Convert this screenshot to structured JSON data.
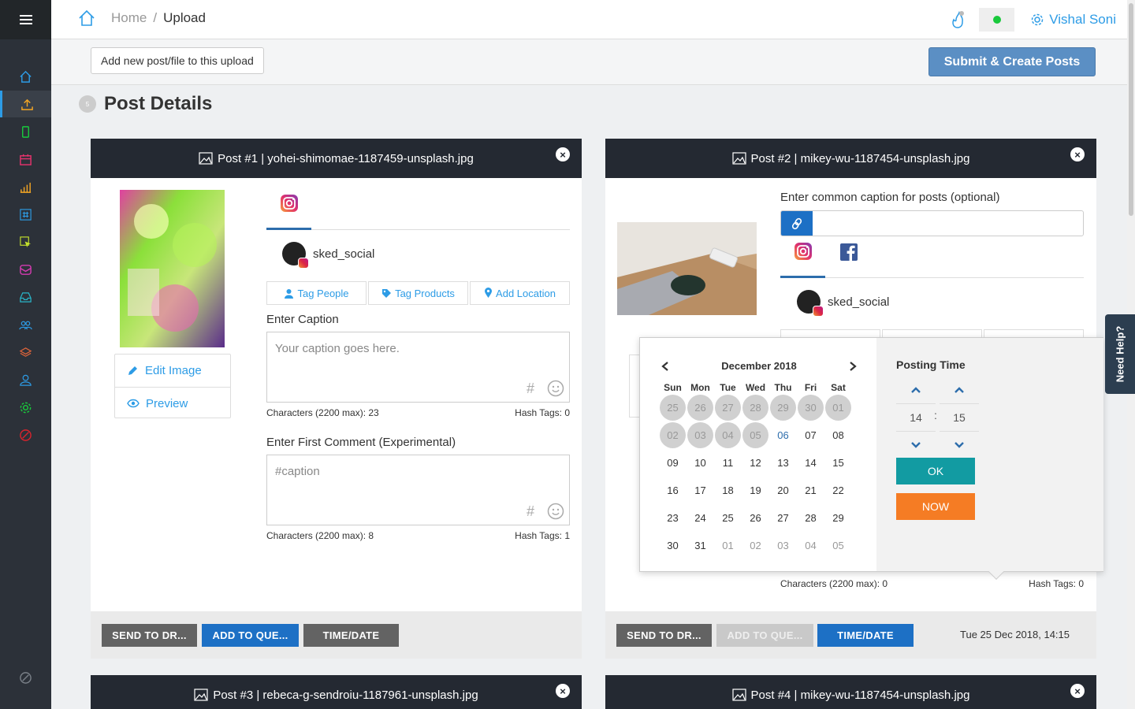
{
  "colors": {
    "sidebar": "#2c3139",
    "accent": "#2d9ce6",
    "primary_button": "#1d70c5",
    "submit_button": "#5b8fc4",
    "ok_button": "#129ba2",
    "now_button": "#f57c24",
    "status_online": "#19c93c"
  },
  "sidebar": {
    "items": [
      "home-icon",
      "upload-icon",
      "phone-icon",
      "calendar-icon",
      "bar-chart-icon",
      "hashtag-icon",
      "cursor-icon",
      "inbox-icon",
      "tray-icon",
      "users-icon",
      "layers-icon",
      "user-icon",
      "gear-icon",
      "blocked-icon"
    ],
    "bottom_icon": "circle-slash-icon"
  },
  "header": {
    "breadcrumb_home": "Home",
    "breadcrumb_sep": "/",
    "breadcrumb_current": "Upload",
    "user_name": "Vishal Soni"
  },
  "toolbar": {
    "add_new_label": "Add new post/file to this upload",
    "submit_label": "Submit & Create Posts"
  },
  "section": {
    "number": "5",
    "title": "Post Details"
  },
  "posts": [
    {
      "header": "Post #1 | yohei-shimomae-1187459-unsplash.jpg",
      "edit_image": "Edit Image",
      "preview": "Preview",
      "account": "sked_social",
      "tag_people": "Tag People",
      "tag_products": "Tag Products",
      "add_location": "Add Location",
      "caption_label": "Enter Caption",
      "caption_placeholder": "Your caption goes here.",
      "caption_chars": "Characters (2200 max): 23",
      "caption_hashtags": "Hash Tags: 0",
      "comment_label": "Enter First Comment (Experimental)",
      "comment_placeholder": "#caption",
      "comment_chars": "Characters (2200 max): 8",
      "comment_hashtags": "Hash Tags: 1",
      "btn_draft": "SEND TO DR...",
      "btn_queue": "ADD TO QUE...",
      "btn_time": "TIME/DATE"
    },
    {
      "header": "Post #2 | mikey-wu-1187454-unsplash.jpg",
      "common_caption_label": "Enter common caption for posts (optional)",
      "account": "sked_social",
      "caption_chars": "Characters (2200 max): 0",
      "caption_hashtags": "Hash Tags: 0",
      "btn_draft": "SEND TO DR...",
      "btn_queue": "ADD TO QUE...",
      "btn_time": "TIME/DATE",
      "scheduled": "Tue 25 Dec 2018, 14:15"
    },
    {
      "header": "Post #3 | rebeca-g-sendroiu-1187961-unsplash.jpg"
    },
    {
      "header": "Post #4 | mikey-wu-1187454-unsplash.jpg"
    }
  ],
  "picker": {
    "month_label": "December 2018",
    "weekdays": [
      "Sun",
      "Mon",
      "Tue",
      "Wed",
      "Thu",
      "Fri",
      "Sat"
    ],
    "weeks": [
      [
        "25",
        "26",
        "27",
        "28",
        "29",
        "30",
        "01"
      ],
      [
        "02",
        "03",
        "04",
        "05",
        "06",
        "07",
        "08"
      ],
      [
        "09",
        "10",
        "11",
        "12",
        "13",
        "14",
        "15"
      ],
      [
        "16",
        "17",
        "18",
        "19",
        "20",
        "21",
        "22"
      ],
      [
        "23",
        "24",
        "25",
        "26",
        "27",
        "28",
        "29"
      ],
      [
        "30",
        "31",
        "01",
        "02",
        "03",
        "04",
        "05"
      ]
    ],
    "time_title": "Posting Time",
    "hour": "14",
    "minute": "15",
    "time_sep": ":",
    "ok_label": "OK",
    "now_label": "NOW"
  },
  "need_help": "Need Help?"
}
